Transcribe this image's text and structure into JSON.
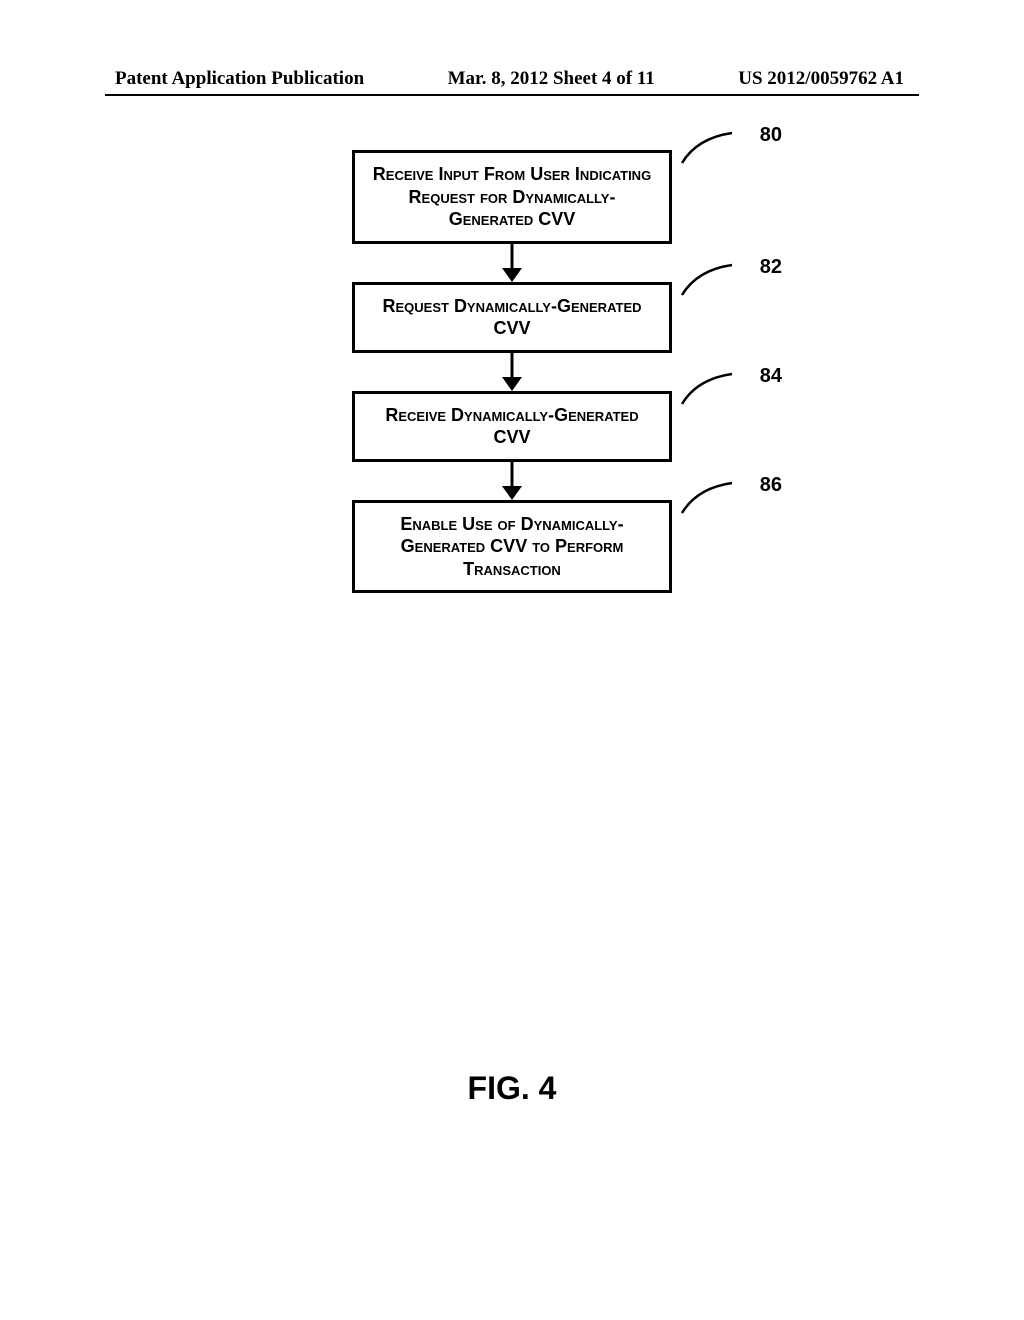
{
  "header": {
    "left": "Patent Application Publication",
    "center": "Mar. 8, 2012  Sheet 4 of 11",
    "right": "US 2012/0059762 A1"
  },
  "chart_data": {
    "type": "flowchart",
    "title": "FIG. 4",
    "steps": [
      {
        "id": 80,
        "text": "Receive Input From User Indicating Request for Dynamically-Generated CVV"
      },
      {
        "id": 82,
        "text": "Request Dynamically-Generated CVV"
      },
      {
        "id": 84,
        "text": "Receive Dynamically-Generated CVV"
      },
      {
        "id": 86,
        "text": "Enable Use of Dynamically-Generated CVV to Perform Transaction"
      }
    ],
    "edges": [
      {
        "from": 80,
        "to": 82
      },
      {
        "from": 82,
        "to": 84
      },
      {
        "from": 84,
        "to": 86
      }
    ]
  },
  "labels": {
    "l80": "80",
    "l82": "82",
    "l84": "84",
    "l86": "86"
  },
  "figure_label": "FIG. 4"
}
